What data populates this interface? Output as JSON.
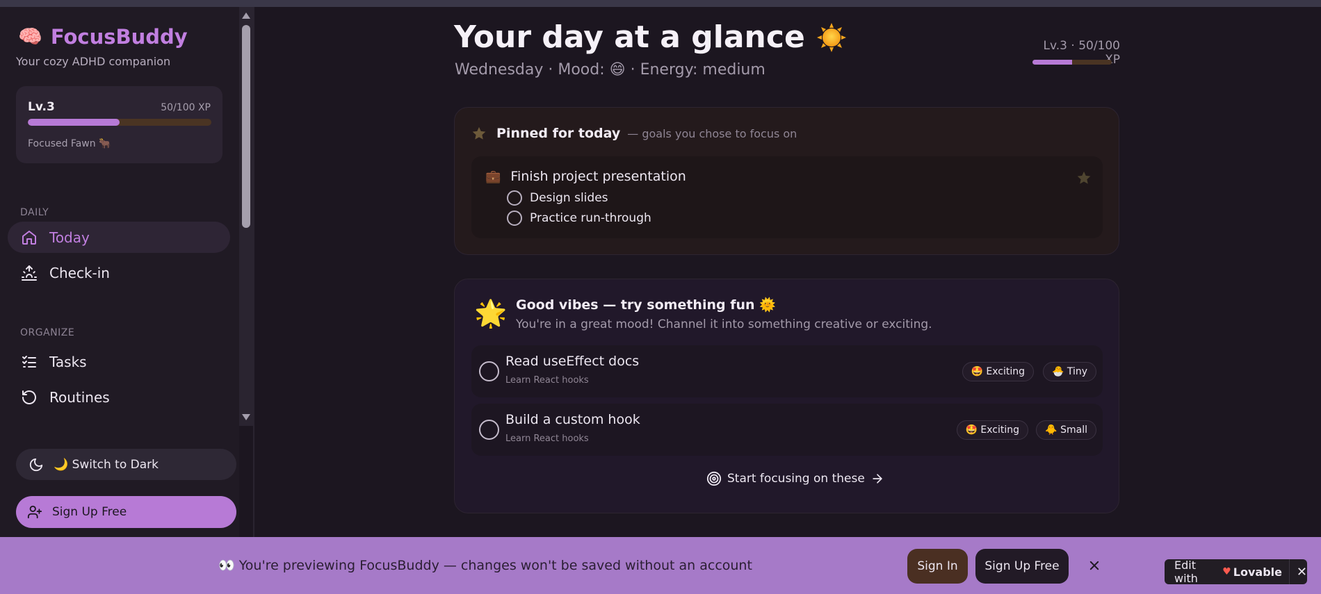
{
  "app": {
    "brand_icon": "🧠",
    "name": "FocusBuddy",
    "tagline": "Your cozy ADHD companion"
  },
  "level_card": {
    "level": "Lv.3",
    "xp": "50/100 XP",
    "progress": 0.5,
    "companion": "Focused Fawn 🐂"
  },
  "sidebar": {
    "daily_label": "DAILY",
    "daily_items": [
      {
        "label": "Today",
        "icon": "home-icon",
        "active": true
      },
      {
        "label": "Check-in",
        "icon": "sunrise-icon",
        "active": false
      }
    ],
    "organize_label": "ORGANIZE",
    "organize_items": [
      {
        "label": "Tasks",
        "icon": "list-checks-icon"
      },
      {
        "label": "Routines",
        "icon": "rotate-ccw-icon"
      }
    ],
    "theme_button": "🌙 Switch to Dark",
    "signup_button": "Sign Up Free"
  },
  "header": {
    "title": "Your day at a glance",
    "subtitle_prefix": "Wednesday · Mood:",
    "mood_emoji": "😄",
    "subtitle_suffix": "· Energy: medium",
    "xp_mini": "Lv.3 · 50/100 XP",
    "xp_progress": 0.5
  },
  "pinned": {
    "title": "Pinned for today",
    "subtitle": "— goals you chose to focus on",
    "goal": {
      "icon": "💼",
      "title": "Finish project presentation",
      "subtasks": [
        "Design slides",
        "Practice run-through"
      ]
    }
  },
  "vibes": {
    "burst": "🌟",
    "title": "Good vibes — try something fun 🌞",
    "description": "You're in a great mood! Channel it into something creative or exciting.",
    "tasks": [
      {
        "title": "Read useEffect docs",
        "subtitle": "Learn React hooks",
        "chips": [
          "🤩 Exciting",
          "🐣 Tiny"
        ]
      },
      {
        "title": "Build a custom hook",
        "subtitle": "Learn React hooks",
        "chips": [
          "🤩 Exciting",
          "🐥 Small"
        ]
      }
    ],
    "cta": "Start focusing on these"
  },
  "banner": {
    "text": "👀 You're previewing FocusBuddy — changes won't be saved without an account",
    "signin": "Sign In",
    "signup": "Sign Up Free"
  },
  "lovable": {
    "prefix": "Edit with",
    "brand": "Lovable"
  },
  "colors": {
    "accent": "#b77ad6",
    "background": "#1c1620",
    "banner": "#a67ac8"
  }
}
